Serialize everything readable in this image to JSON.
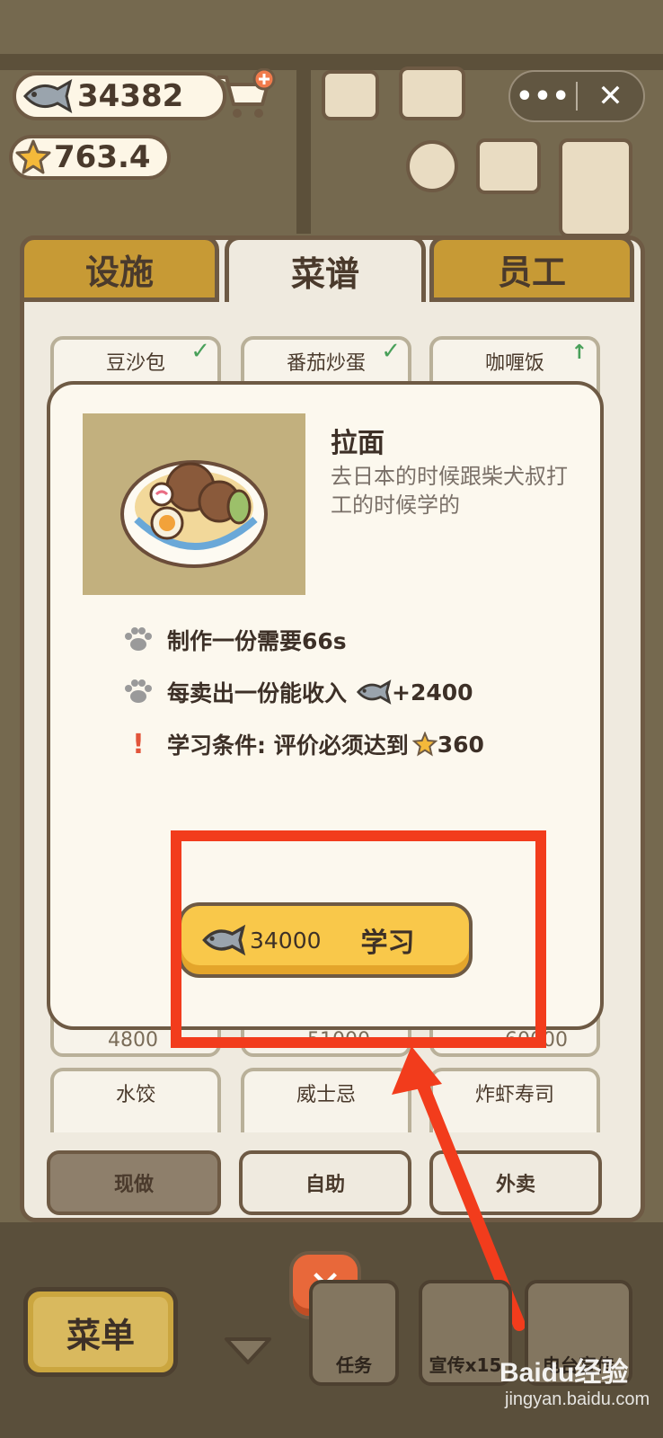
{
  "currency": {
    "fish": "34382",
    "stars": "763.4"
  },
  "window": {
    "more_label": "•••",
    "close_label": "✕"
  },
  "tabs": [
    {
      "label": "设施",
      "active": false
    },
    {
      "label": "菜谱",
      "active": true
    },
    {
      "label": "员工",
      "active": false
    }
  ],
  "dishes_top": [
    {
      "name": "豆沙包",
      "status": "learned"
    },
    {
      "name": "番茄炒蛋",
      "status": "learned"
    },
    {
      "name": "咖喱饭",
      "status": "upgradable"
    }
  ],
  "dishes_prices_peek": [
    "4800",
    "51000",
    "60000"
  ],
  "dishes_second": [
    {
      "name": "水饺"
    },
    {
      "name": "威士忌"
    },
    {
      "name": "炸虾寿司"
    }
  ],
  "mode_tabs": [
    {
      "label": "现做",
      "active": true
    },
    {
      "label": "自助",
      "active": false
    },
    {
      "label": "外卖",
      "active": false
    }
  ],
  "modal": {
    "title": "拉面",
    "description": "去日本的时候跟柴犬叔打工的时候学的",
    "info": [
      {
        "icon": "paw-icon",
        "text_prefix": "制作一份需要66s",
        "suffix": ""
      },
      {
        "icon": "paw-icon",
        "text_prefix": "每卖出一份能收入",
        "suffix": "+2400"
      },
      {
        "icon": "exclamation-icon",
        "text_prefix": "学习条件: 评价必须达到",
        "suffix": "360"
      }
    ],
    "learn_cost": "34000",
    "learn_label": "学习"
  },
  "hud": {
    "menu_label": "菜单",
    "task_label": "任务",
    "promo_label": "宣传x15",
    "radio_label": "电台宣传"
  },
  "watermark": {
    "brand": "Baidu经验",
    "url": "jingyan.baidu.com"
  },
  "colors": {
    "accent_yellow": "#f9c84a",
    "annotation_red": "#f23c1c",
    "tab_gold": "#c79a35",
    "outline_brown": "#6e5a44"
  }
}
